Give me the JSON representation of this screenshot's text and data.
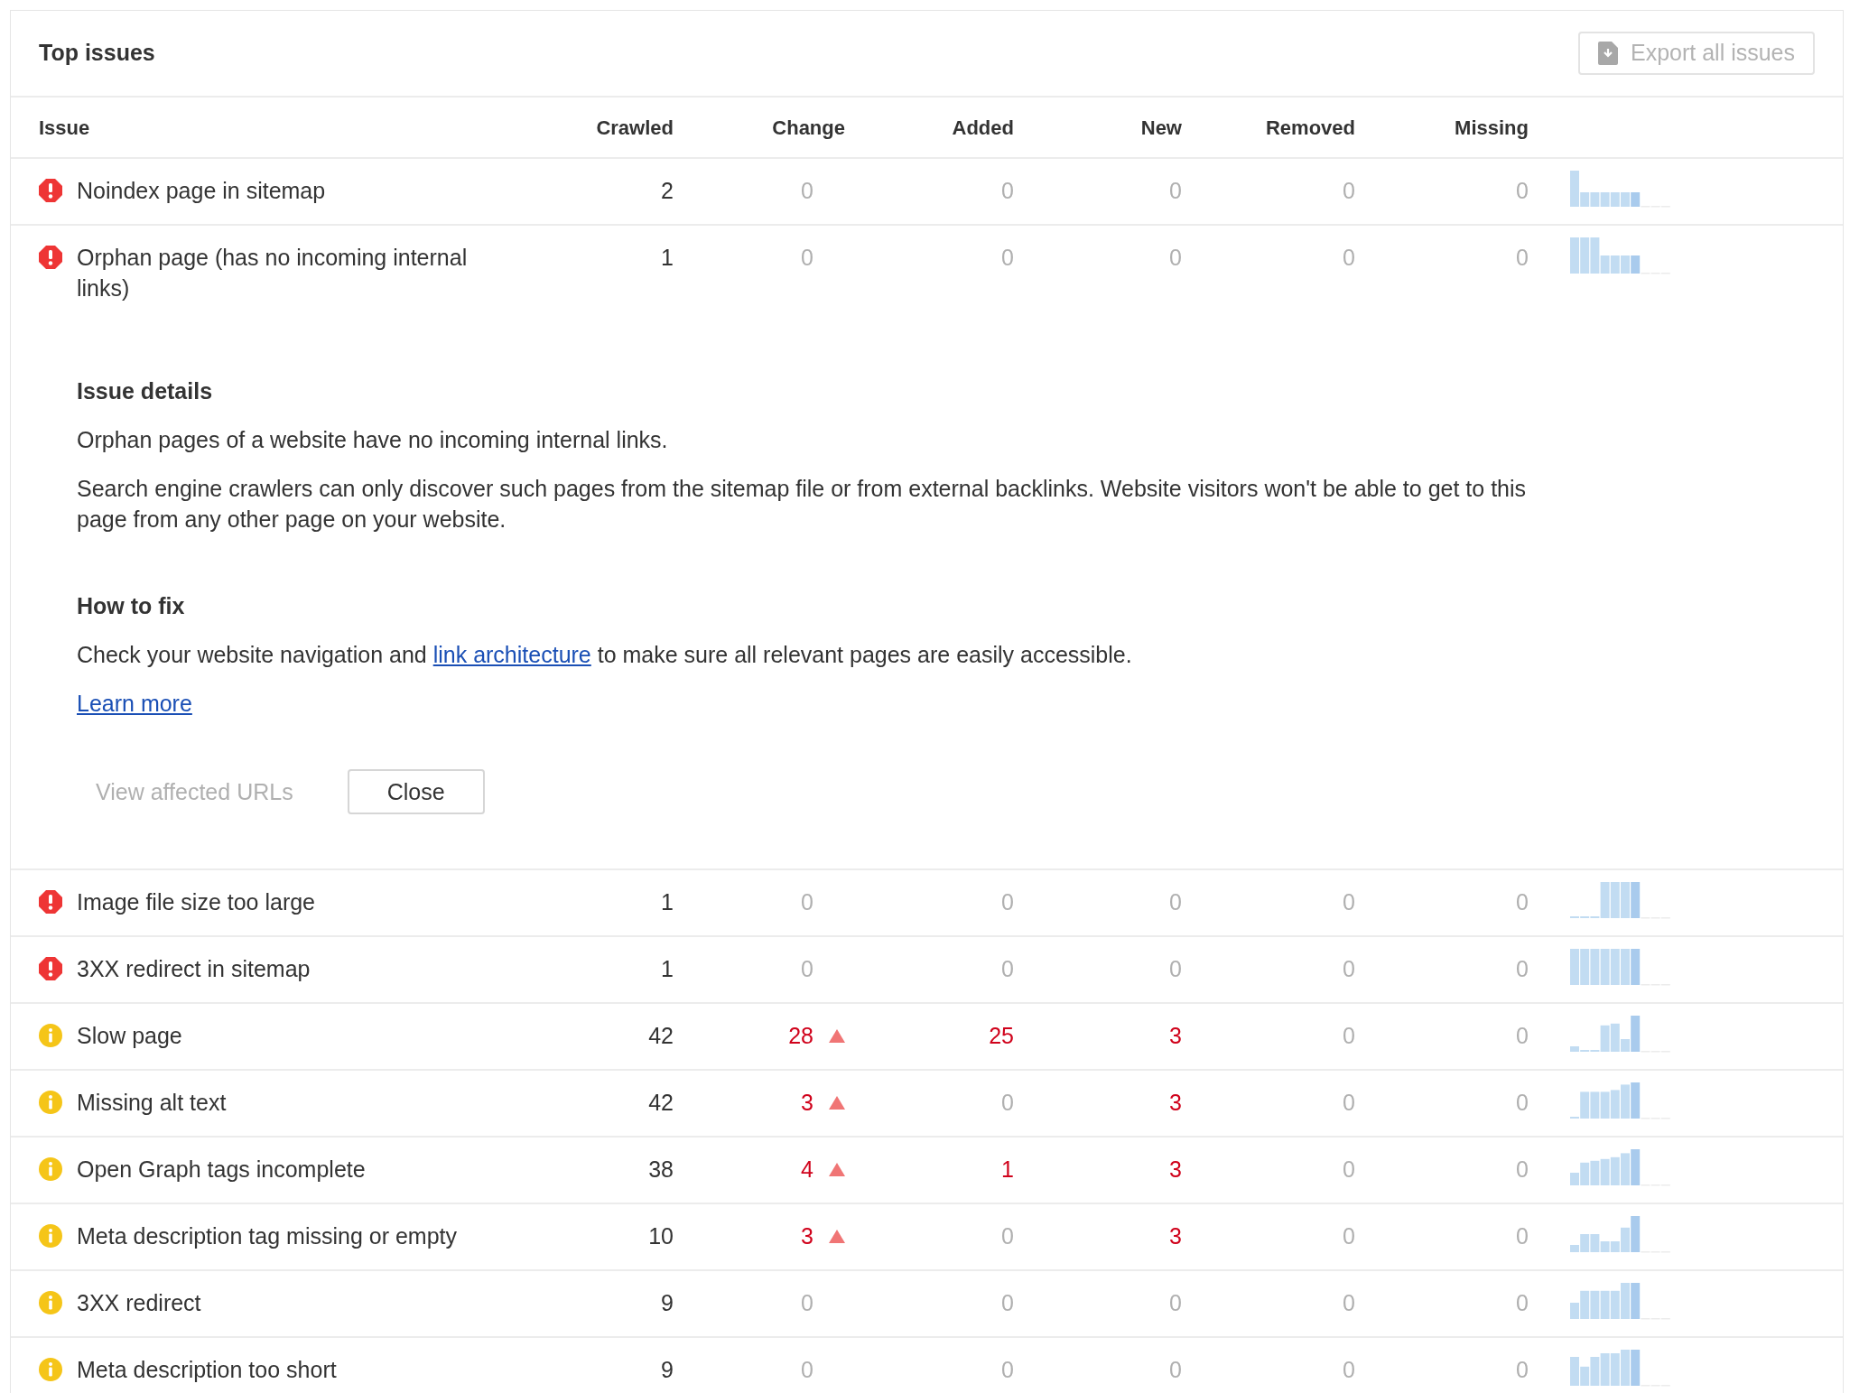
{
  "panel": {
    "title": "Top issues",
    "export_button": "Export all issues"
  },
  "columns": [
    "Issue",
    "Crawled",
    "Change",
    "Added",
    "New",
    "Removed",
    "Missing"
  ],
  "rows": [
    {
      "kind": "error",
      "issue": "Noindex page in sitemap",
      "crawled": "2",
      "expanded": false,
      "cells": [
        {
          "text": "0",
          "increased": false
        },
        {
          "text": "0",
          "increased": false
        },
        {
          "text": "0",
          "increased": false
        },
        {
          "text": "0",
          "increased": false
        },
        {
          "text": "0",
          "increased": false
        }
      ]
    },
    {
      "kind": "error",
      "issue": "Orphan page (has no incoming internal links)",
      "crawled": "1",
      "expanded": true,
      "cells": [
        {
          "text": "0",
          "increased": false
        },
        {
          "text": "0",
          "increased": false
        },
        {
          "text": "0",
          "increased": false
        },
        {
          "text": "0",
          "increased": false
        },
        {
          "text": "0",
          "increased": false
        }
      ]
    },
    {
      "kind": "error",
      "issue": "Image file size too large",
      "crawled": "1",
      "expanded": false,
      "cells": [
        {
          "text": "0",
          "increased": false
        },
        {
          "text": "0",
          "increased": false
        },
        {
          "text": "0",
          "increased": false
        },
        {
          "text": "0",
          "increased": false
        },
        {
          "text": "0",
          "increased": false
        }
      ]
    },
    {
      "kind": "error",
      "issue": "3XX redirect in sitemap",
      "crawled": "1",
      "expanded": false,
      "cells": [
        {
          "text": "0",
          "increased": false
        },
        {
          "text": "0",
          "increased": false
        },
        {
          "text": "0",
          "increased": false
        },
        {
          "text": "0",
          "increased": false
        },
        {
          "text": "0",
          "increased": false
        }
      ]
    },
    {
      "kind": "warning",
      "issue": "Slow page",
      "crawled": "42",
      "expanded": false,
      "cells": [
        {
          "text": "28",
          "increased": true
        },
        {
          "text": "25",
          "increased": true
        },
        {
          "text": "3",
          "increased": true
        },
        {
          "text": "0",
          "increased": false
        },
        {
          "text": "0",
          "increased": false
        }
      ]
    },
    {
      "kind": "warning",
      "issue": "Missing alt text",
      "crawled": "42",
      "expanded": false,
      "cells": [
        {
          "text": "3",
          "increased": true
        },
        {
          "text": "0",
          "increased": false
        },
        {
          "text": "3",
          "increased": true
        },
        {
          "text": "0",
          "increased": false
        },
        {
          "text": "0",
          "increased": false
        }
      ]
    },
    {
      "kind": "warning",
      "issue": "Open Graph tags incomplete",
      "crawled": "38",
      "expanded": false,
      "cells": [
        {
          "text": "4",
          "increased": true
        },
        {
          "text": "1",
          "increased": true
        },
        {
          "text": "3",
          "increased": true
        },
        {
          "text": "0",
          "increased": false
        },
        {
          "text": "0",
          "increased": false
        }
      ]
    },
    {
      "kind": "warning",
      "issue": "Meta description tag missing or empty",
      "crawled": "10",
      "expanded": false,
      "cells": [
        {
          "text": "3",
          "increased": true
        },
        {
          "text": "0",
          "increased": false
        },
        {
          "text": "3",
          "increased": true
        },
        {
          "text": "0",
          "increased": false
        },
        {
          "text": "0",
          "increased": false
        }
      ]
    },
    {
      "kind": "warning",
      "issue": "3XX redirect",
      "crawled": "9",
      "expanded": false,
      "cells": [
        {
          "text": "0",
          "increased": false
        },
        {
          "text": "0",
          "increased": false
        },
        {
          "text": "0",
          "increased": false
        },
        {
          "text": "0",
          "increased": false
        },
        {
          "text": "0",
          "increased": false
        }
      ]
    },
    {
      "kind": "warning",
      "issue": "Meta description too short",
      "crawled": "9",
      "expanded": false,
      "cells": [
        {
          "text": "0",
          "increased": false
        },
        {
          "text": "0",
          "increased": false
        },
        {
          "text": "0",
          "increased": false
        },
        {
          "text": "0",
          "increased": false
        },
        {
          "text": "0",
          "increased": false
        }
      ]
    }
  ],
  "details": {
    "title": "Issue details",
    "paragraphs": [
      "Orphan pages of a website have no incoming internal links.",
      "Search engine crawlers can only discover such pages from the sitemap file or from external backlinks. Website visitors won't be able to get to this page from any other page on your website."
    ],
    "fix_title": "How to fix",
    "fix_before": "Check your website navigation and ",
    "fix_link": "link architecture",
    "fix_after": " to make sure all relevant pages are easily accessible.",
    "learn_more": "Learn more",
    "view_button": "View affected URLs",
    "close_button": "Close"
  }
}
